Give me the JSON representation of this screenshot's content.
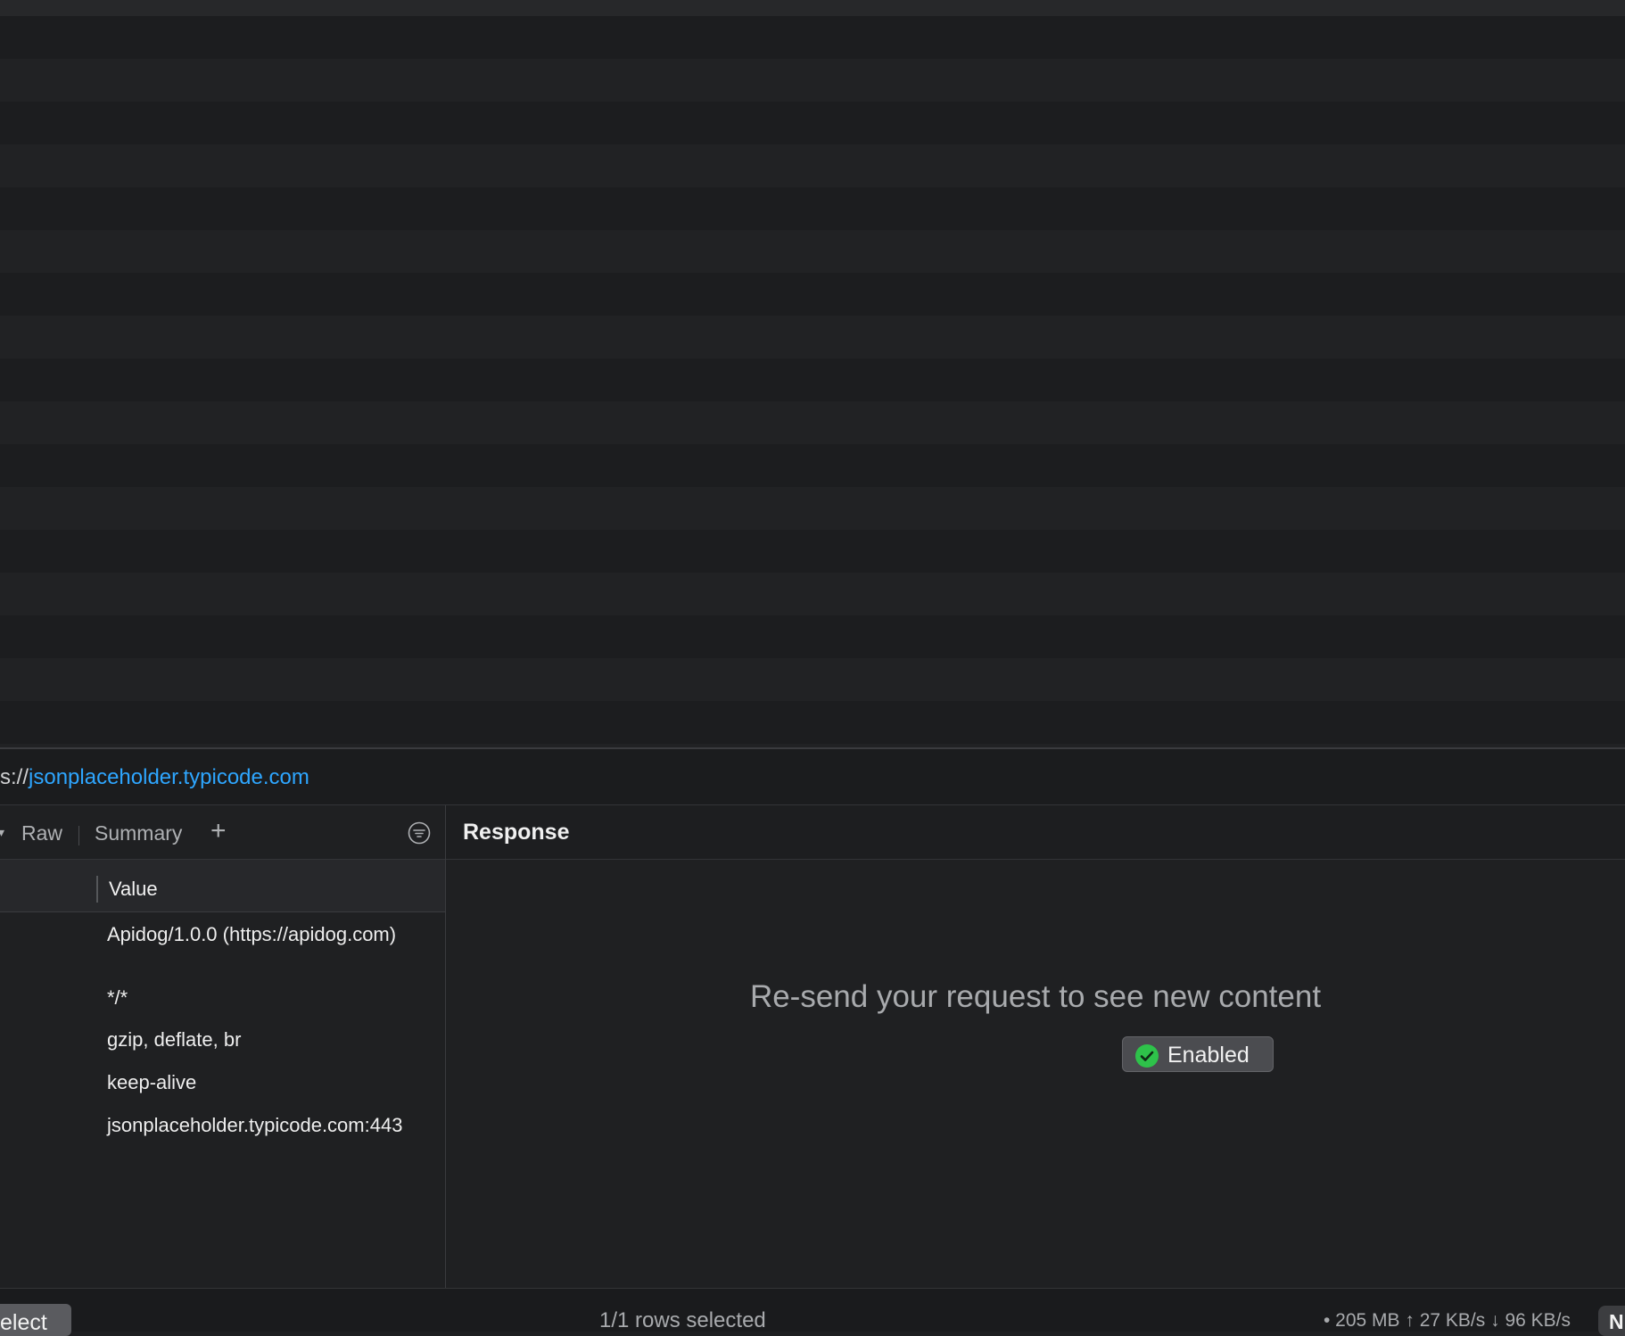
{
  "url": {
    "scheme_fragment": "s://",
    "host": "jsonplaceholder.typicode.com"
  },
  "request_panel": {
    "tabs": {
      "raw": "Raw",
      "summary": "Summary",
      "add": "+"
    },
    "column_header": "Value",
    "values": [
      "Apidog/1.0.0 (https://apidog.com)",
      "*/*",
      "gzip, deflate, br",
      "keep-alive",
      "jsonplaceholder.typicode.com:443"
    ]
  },
  "response_panel": {
    "title": "Response",
    "message": "Re-send your request to see new content",
    "badge": "Enabled"
  },
  "status_bar": {
    "select_button": "elect",
    "rows_selected": "1/1 rows selected",
    "stats": "• 205 MB ↑ 27 KB/s ↓ 96 KB/s",
    "badge": "N"
  },
  "colors": {
    "link": "#2ea6ff",
    "success": "#2ec24a"
  },
  "icons": [
    "chevron-down-icon",
    "plus-icon",
    "filter-icon",
    "checkmark-circle-icon"
  ]
}
